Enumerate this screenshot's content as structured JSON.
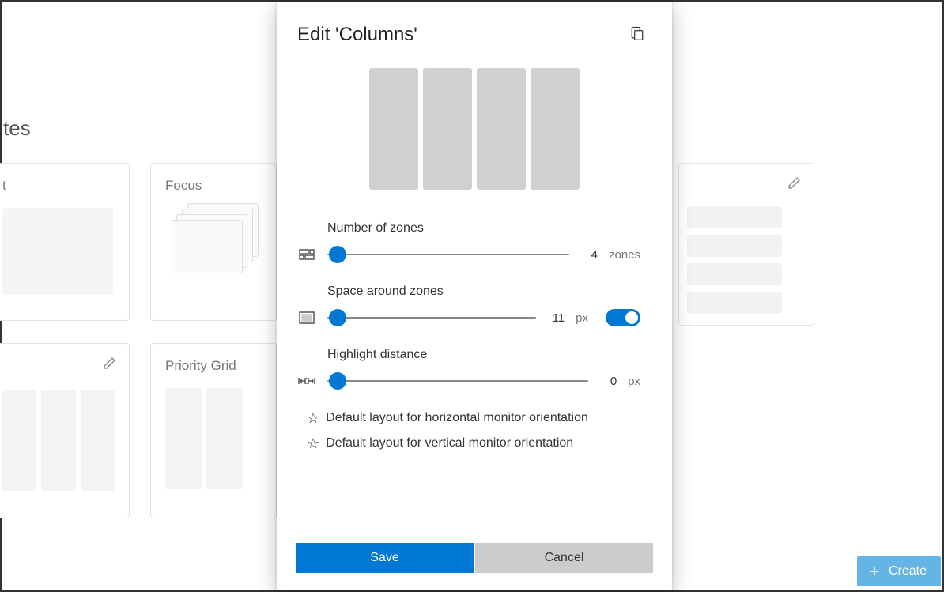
{
  "background": {
    "header_suffix": "tes",
    "cards": {
      "focus": {
        "title": "Focus"
      },
      "priority_grid": {
        "title": "Priority Grid"
      }
    },
    "create_button": "Create"
  },
  "dialog": {
    "title": "Edit 'Columns'",
    "settings": {
      "zones": {
        "label": "Number of zones",
        "value": "4",
        "unit": "zones"
      },
      "space": {
        "label": "Space around zones",
        "value": "11",
        "unit": "px"
      },
      "highlight": {
        "label": "Highlight distance",
        "value": "0",
        "unit": "px"
      }
    },
    "defaults": {
      "horizontal": "Default layout for horizontal monitor orientation",
      "vertical": "Default layout for vertical monitor orientation"
    },
    "buttons": {
      "save": "Save",
      "cancel": "Cancel"
    }
  }
}
